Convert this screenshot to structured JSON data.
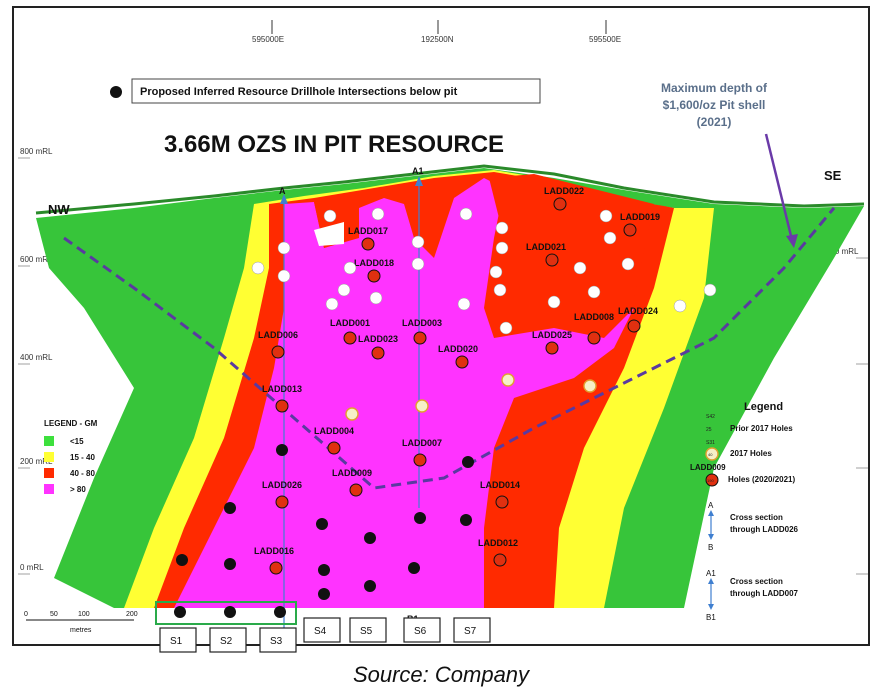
{
  "map": {
    "eastings": [
      "595000E",
      "192500N",
      "595500E"
    ],
    "rl_left": [
      "800 mRL",
      "600 mRL",
      "400 mRL",
      "200 mRL",
      "0 mRL"
    ],
    "rl_right": [
      "600 mRL"
    ],
    "title": "3.66M OZS IN PIT RESOURCE",
    "proposed_label": "Proposed Inferred Resource Drillhole Intersections below pit",
    "max_depth_label": [
      "Maximum depth of",
      "$1,600/oz Pit shell",
      "(2021)"
    ],
    "directions": {
      "nw": "NW",
      "se": "SE"
    },
    "section_letters": {
      "a": "A",
      "a1": "A1",
      "b": "B",
      "b1": "B1"
    },
    "scale": {
      "ticks": [
        "0",
        "50",
        "100",
        "200"
      ],
      "unit": "metres"
    },
    "sections": [
      "S1",
      "S2",
      "S3",
      "S4",
      "S5",
      "S6",
      "S7"
    ],
    "holes": [
      {
        "id": "LADD017"
      },
      {
        "id": "LADD018"
      },
      {
        "id": "LADD022"
      },
      {
        "id": "LADD019"
      },
      {
        "id": "LADD021"
      },
      {
        "id": "LADD006"
      },
      {
        "id": "LADD001"
      },
      {
        "id": "LADD023"
      },
      {
        "id": "LADD003"
      },
      {
        "id": "LADD020"
      },
      {
        "id": "LADD025"
      },
      {
        "id": "LADD008"
      },
      {
        "id": "LADD024"
      },
      {
        "id": "LADD013"
      },
      {
        "id": "LADD004"
      },
      {
        "id": "LADD007"
      },
      {
        "id": "LADD009"
      },
      {
        "id": "LADD026"
      },
      {
        "id": "LADD014"
      },
      {
        "id": "LADD012"
      },
      {
        "id": "LADD016"
      }
    ]
  },
  "grade_legend": {
    "title": "LEGEND  - GM",
    "items": [
      {
        "label": "<15",
        "color": "#3de03d"
      },
      {
        "label": "15 - 40",
        "color": "#ffff33"
      },
      {
        "label": "40 - 80",
        "color": "#ff2a00"
      },
      {
        "label": "> 80",
        "color": "#ff33ff"
      }
    ]
  },
  "legend": {
    "title": "Legend",
    "prior_code": "S42",
    "prior_num": "25",
    "prior": "Prior 2017 Holes",
    "h2017_code": "S31",
    "h2017_num": "40",
    "h2017": "2017 Holes",
    "new_code": "LADD009",
    "new_num": "190",
    "new": "Holes (2020/2021)",
    "xsec1": "Cross section through LADD026",
    "xsec2": "Cross section through LADD007",
    "xsec1_letters": [
      "A",
      "B"
    ],
    "xsec2_letters": [
      "A1",
      "B1"
    ]
  },
  "source": "Source: Company"
}
